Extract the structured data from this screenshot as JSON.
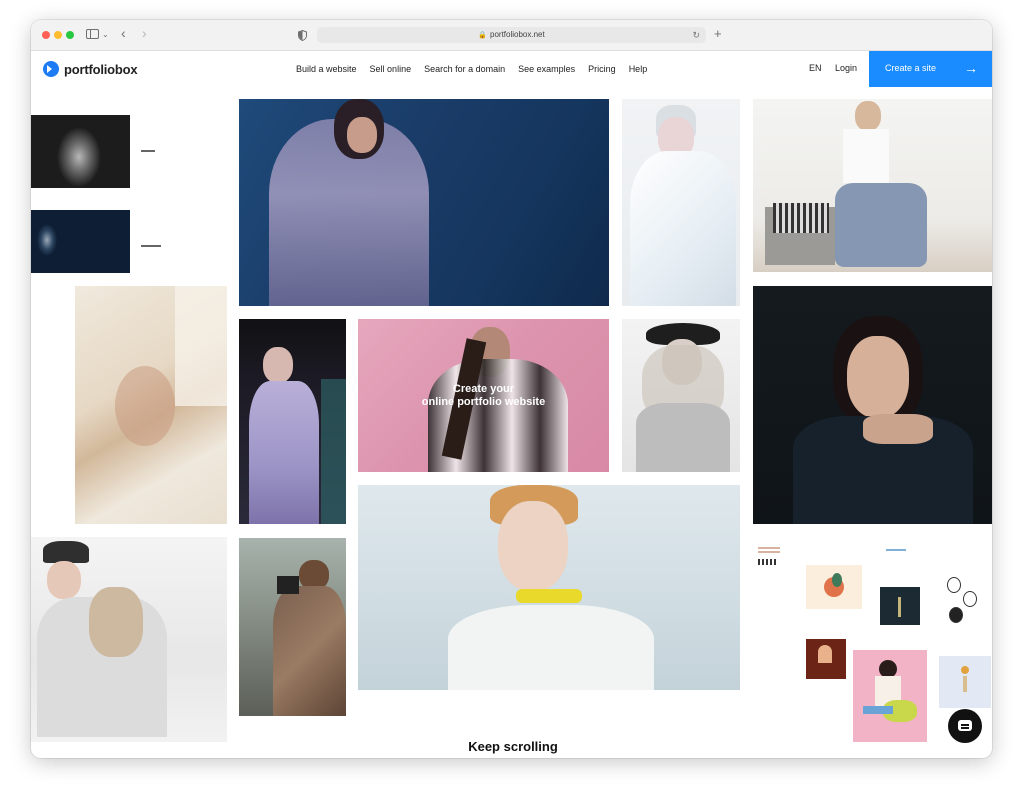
{
  "browser": {
    "url": "portfoliobox.net",
    "colors": {
      "close": "#ff5f57",
      "minimize": "#febc2e",
      "maximize": "#28c840"
    },
    "icons": [
      "sidebar-icon",
      "chevron-down-icon",
      "back-icon",
      "forward-icon",
      "shield-icon",
      "lock-icon",
      "reload-icon",
      "new-tab-icon"
    ]
  },
  "header": {
    "logo_text": "portfoliobox",
    "nav_items": [
      "Build a website",
      "Sell online",
      "Search for a domain",
      "See examples",
      "Pricing",
      "Help"
    ],
    "lang": "EN",
    "login": "Login",
    "cta_label": "Create a site",
    "cta_color": "#1a8cff"
  },
  "hero": {
    "headline_line1": "Create your",
    "headline_line2": "online portfolio website"
  },
  "footer": {
    "keep_scrolling": "Keep scrolling"
  }
}
